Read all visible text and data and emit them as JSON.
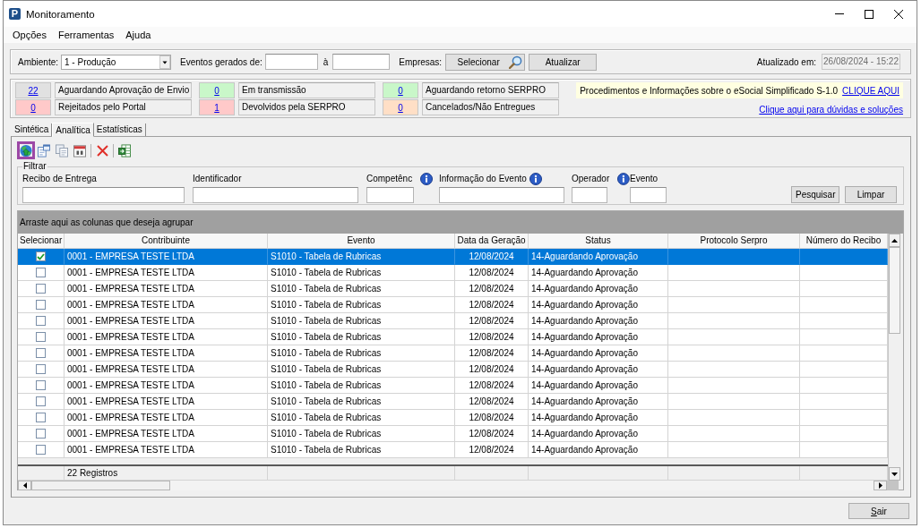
{
  "window": {
    "icon_letter": "P",
    "title": "Monitoramento"
  },
  "menu": [
    {
      "label": "Opções"
    },
    {
      "label": "Ferramentas"
    },
    {
      "label": "Ajuda"
    }
  ],
  "top_bar": {
    "environment_label": "Ambiente:",
    "environment_value": "1 - Produção",
    "events_label": "Eventos gerados de:",
    "range_separator": "à",
    "companies_label": "Empresas:",
    "select_button": "Selecionar",
    "refresh_button": "Atualizar",
    "updated_label": "Atualizado em:",
    "updated_value": "26/08/2024 - 15:22",
    "updated_disabled": true
  },
  "counters": [
    {
      "count": "22",
      "label": "Aguardando Aprovação de Envio",
      "color": "#e1e1e1"
    },
    {
      "count": "0",
      "label": "Em transmissão",
      "color": "#c9f7c9"
    },
    {
      "count": "0",
      "label": "Aguardando retorno SERPRO",
      "color": "#c9f7c9"
    },
    {
      "count": "0",
      "label": "Rejeitados pelo Portal",
      "color": "#ffc9c9"
    },
    {
      "count": "1",
      "label": "Devolvidos pela SERPRO",
      "color": "#ffc9c9"
    },
    {
      "count": "0",
      "label": "Cancelados/Não Entregues",
      "color": "#ffdfc6"
    }
  ],
  "notice": {
    "text": "Procedimentos e Informações sobre o eSocial Simplificado S-1.0",
    "link": "CLIQUE AQUI"
  },
  "help_link": "Clique aqui para dúvidas e soluções",
  "tabs": [
    {
      "label": "Sintética",
      "selected": false
    },
    {
      "label": "Analítica",
      "selected": true
    },
    {
      "label": "Estatísticas",
      "selected": false
    }
  ],
  "toolbar": [
    {
      "kind": "button",
      "highlighted": true
    },
    {
      "kind": "button",
      "highlighted": false
    },
    {
      "kind": "button",
      "highlighted": false
    },
    {
      "kind": "button",
      "highlighted": false
    },
    {
      "kind": "separator"
    },
    {
      "kind": "button",
      "highlighted": false
    },
    {
      "kind": "separator"
    },
    {
      "kind": "button",
      "highlighted": false
    }
  ],
  "filter": {
    "title": "Filtrar",
    "fields": [
      {
        "label": "Recibo de Entrega",
        "info": false
      },
      {
        "label": "Identificador",
        "info": false
      },
      {
        "label": "Competênc",
        "info": true
      },
      {
        "label": "Informação do Evento",
        "info": true
      },
      {
        "label": "Operador",
        "info": true
      },
      {
        "label": "Evento",
        "info": false
      }
    ],
    "search_button": "Pesquisar",
    "clear_button": "Limpar"
  },
  "grid": {
    "group_hint": "Arraste aqui as colunas que deseja agrupar",
    "columns": [
      "Selecionar",
      "Contribuinte",
      "Evento",
      "Data da Geração",
      "Status",
      "Protocolo Serpro",
      "Número do Recibo"
    ],
    "rows": [
      {
        "selected": true,
        "checked": true,
        "cells": [
          "",
          "0001 - EMPRESA TESTE LTDA",
          "S1010 - Tabela de Rubricas",
          "12/08/2024",
          "14-Aguardando Aprovação"
        ]
      },
      {
        "selected": false,
        "checked": false,
        "cells": [
          "",
          "0001 - EMPRESA TESTE LTDA",
          "S1010 - Tabela de Rubricas",
          "12/08/2024",
          "14-Aguardando Aprovação"
        ]
      },
      {
        "selected": false,
        "checked": false,
        "cells": [
          "",
          "0001 - EMPRESA TESTE LTDA",
          "S1010 - Tabela de Rubricas",
          "12/08/2024",
          "14-Aguardando Aprovação"
        ]
      },
      {
        "selected": false,
        "checked": false,
        "cells": [
          "",
          "0001 - EMPRESA TESTE LTDA",
          "S1010 - Tabela de Rubricas",
          "12/08/2024",
          "14-Aguardando Aprovação"
        ]
      },
      {
        "selected": false,
        "checked": false,
        "cells": [
          "",
          "0001 - EMPRESA TESTE LTDA",
          "S1010 - Tabela de Rubricas",
          "12/08/2024",
          "14-Aguardando Aprovação"
        ]
      },
      {
        "selected": false,
        "checked": false,
        "cells": [
          "",
          "0001 - EMPRESA TESTE LTDA",
          "S1010 - Tabela de Rubricas",
          "12/08/2024",
          "14-Aguardando Aprovação"
        ]
      },
      {
        "selected": false,
        "checked": false,
        "cells": [
          "",
          "0001 - EMPRESA TESTE LTDA",
          "S1010 - Tabela de Rubricas",
          "12/08/2024",
          "14-Aguardando Aprovação"
        ]
      },
      {
        "selected": false,
        "checked": false,
        "cells": [
          "",
          "0001 - EMPRESA TESTE LTDA",
          "S1010 - Tabela de Rubricas",
          "12/08/2024",
          "14-Aguardando Aprovação"
        ]
      },
      {
        "selected": false,
        "checked": false,
        "cells": [
          "",
          "0001 - EMPRESA TESTE LTDA",
          "S1010 - Tabela de Rubricas",
          "12/08/2024",
          "14-Aguardando Aprovação"
        ]
      },
      {
        "selected": false,
        "checked": false,
        "cells": [
          "",
          "0001 - EMPRESA TESTE LTDA",
          "S1010 - Tabela de Rubricas",
          "12/08/2024",
          "14-Aguardando Aprovação"
        ]
      },
      {
        "selected": false,
        "checked": false,
        "cells": [
          "",
          "0001 - EMPRESA TESTE LTDA",
          "S1010 - Tabela de Rubricas",
          "12/08/2024",
          "14-Aguardando Aprovação"
        ]
      },
      {
        "selected": false,
        "checked": false,
        "cells": [
          "",
          "0001 - EMPRESA TESTE LTDA",
          "S1010 - Tabela de Rubricas",
          "12/08/2024",
          "14-Aguardando Aprovação"
        ]
      },
      {
        "selected": false,
        "checked": false,
        "cells": [
          "",
          "0001 - EMPRESA TESTE LTDA",
          "S1010 - Tabela de Rubricas",
          "12/08/2024",
          "14-Aguardando Aprovação"
        ]
      }
    ],
    "footer": {
      "count": "22 Registros"
    }
  },
  "exit_button": "Sair"
}
